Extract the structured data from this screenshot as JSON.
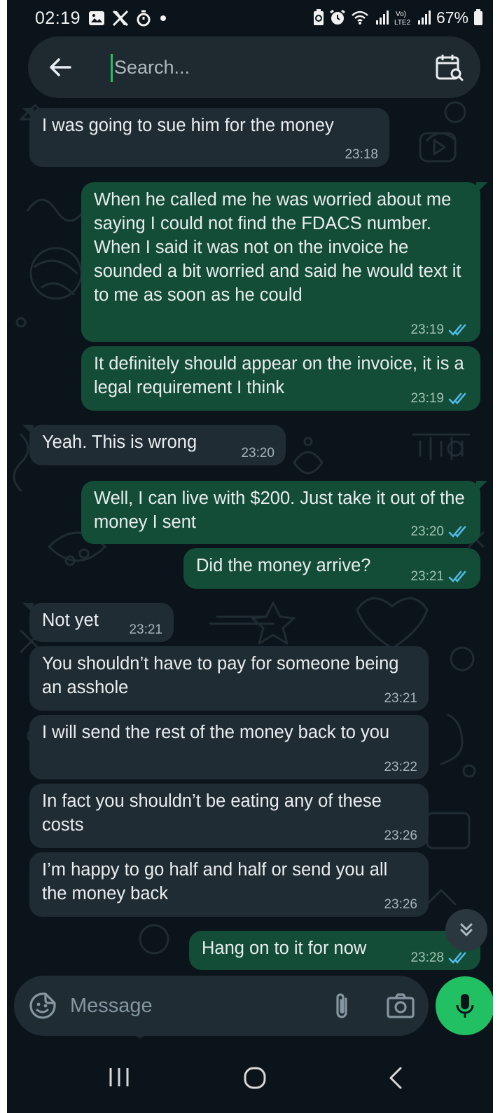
{
  "status_bar": {
    "time": "02:19",
    "battery_percent": "67%",
    "icons_left": [
      "gallery-icon",
      "x-logo-icon",
      "timer-icon",
      "dot-icon"
    ],
    "icons_right": [
      "battery-saver-icon",
      "alarm-icon",
      "wifi-icon",
      "signal-icon",
      "volte-lte2-icon",
      "signal-icon",
      "battery-icon"
    ],
    "volte_label": "Vo)\nLTE2"
  },
  "search": {
    "placeholder": "Search...",
    "value": ""
  },
  "messages": [
    {
      "dir": "in",
      "text": "I was going to sue him for the money",
      "time": "23:18"
    },
    {
      "dir": "out",
      "text": "When he called me he was worried about me saying I could not find the FDACS number. When I said it was not on the invoice he sounded a bit worried and said he would text it to me as soon as he could",
      "time": "23:19",
      "read": true
    },
    {
      "dir": "out",
      "text": "It definitely should appear on the invoice, it is a legal requirement I think",
      "time": "23:19",
      "read": true
    },
    {
      "dir": "in",
      "text": "Yeah. This is wrong",
      "time": "23:20"
    },
    {
      "dir": "out",
      "text": "Well, I can live with $200. Just take it out of the money I sent",
      "time": "23:20",
      "read": true
    },
    {
      "dir": "out",
      "text": "Did the money arrive?",
      "time": "23:21",
      "read": true
    },
    {
      "dir": "in",
      "text": "Not yet",
      "time": "23:21"
    },
    {
      "dir": "in",
      "text": "You shouldn’t have to pay for someone being an asshole",
      "time": "23:21"
    },
    {
      "dir": "in",
      "text": "I will send the rest of the money back to you",
      "time": "23:22"
    },
    {
      "dir": "in",
      "text": "In fact you shouldn’t be eating any of these costs",
      "time": "23:26"
    },
    {
      "dir": "in",
      "text": "I’m happy to go half and half or send you all the money back",
      "time": "23:26"
    },
    {
      "dir": "out",
      "text": "Hang on to it for now",
      "time": "23:28",
      "read": true
    }
  ],
  "composer": {
    "placeholder": "Message",
    "value": ""
  },
  "colors": {
    "background": "#0b141a",
    "incoming_bubble": "#202c33",
    "outgoing_bubble": "#134d37",
    "accent": "#21c063",
    "read_ticks": "#53bdeb"
  }
}
